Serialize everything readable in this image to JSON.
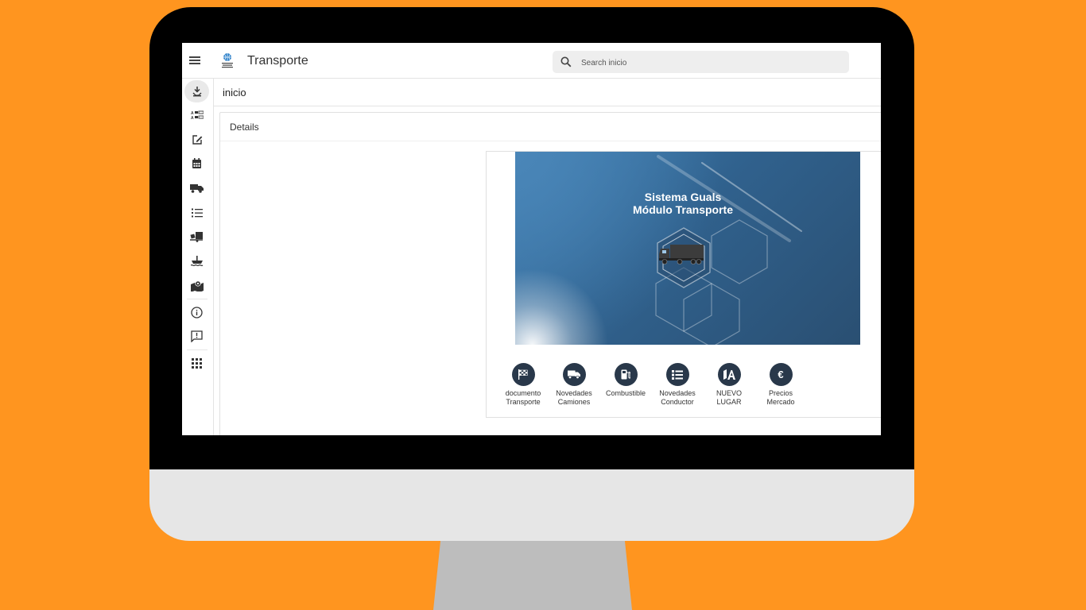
{
  "header": {
    "title": "Transporte",
    "logo_text": "Sistema Guals",
    "search_placeholder": "Search inicio"
  },
  "sidebar": {
    "items": [
      {
        "icon": "download-icon",
        "active": true
      },
      {
        "icon": "list-detail-icon"
      },
      {
        "icon": "edit-icon"
      },
      {
        "icon": "calendar-icon"
      },
      {
        "icon": "truck-icon"
      },
      {
        "icon": "bullet-list-icon"
      },
      {
        "icon": "truck-loading-icon"
      },
      {
        "icon": "ferry-icon"
      },
      {
        "icon": "map-location-icon"
      },
      {
        "icon": "info-icon"
      },
      {
        "icon": "feedback-icon"
      },
      {
        "icon": "apps-grid-icon"
      }
    ]
  },
  "breadcrumb": "inicio",
  "card": {
    "title": "Details"
  },
  "banner": {
    "line1": "Sistema Guals",
    "line2": "Módulo Transporte"
  },
  "quick_actions": [
    {
      "icon": "checkered-flag-icon",
      "line1": "documento",
      "line2": "Transporte"
    },
    {
      "icon": "truck-icon",
      "line1": "Novedades",
      "line2": "Camiones"
    },
    {
      "icon": "fuel-pump-icon",
      "line1": "Combustible",
      "line2": ""
    },
    {
      "icon": "list-icon",
      "line1": "Novedades",
      "line2": "Conductor"
    },
    {
      "icon": "place-icon",
      "line1": "NUEVO",
      "line2": "LUGAR"
    },
    {
      "icon": "euro-icon",
      "glyph": "€",
      "line1": "Precios",
      "line2": "Mercado"
    }
  ],
  "colors": {
    "background": "#FF951F",
    "bezel": "#000000",
    "chin": "#E6E6E6",
    "stand": "#BDBDBD",
    "icon_circle": "#29384A",
    "banner_blue": "#30618D"
  }
}
